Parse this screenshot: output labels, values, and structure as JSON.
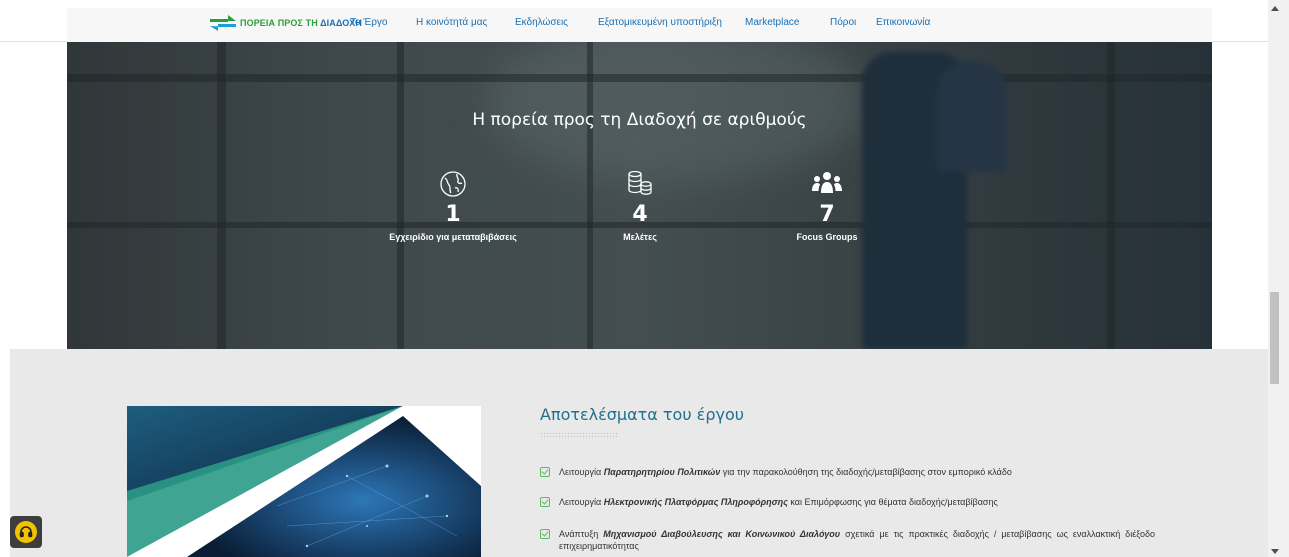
{
  "header": {
    "logo_text_green": "ΠΟΡΕΙΑ ΠΡΟΣ ΤΗ",
    "logo_text_blue": "ΔΙΑΔΟΧΗ",
    "nav": [
      {
        "label": "Το Έργο"
      },
      {
        "label": "Η κοινότητά μας"
      },
      {
        "label": "Εκδηλώσεις"
      },
      {
        "label": "Εξατομικευμένη υποστήριξη"
      },
      {
        "label": "Marketplace"
      },
      {
        "label": "Πόροι"
      },
      {
        "label": "Επικοινωνία"
      }
    ]
  },
  "hero": {
    "title": "Η πορεία προς τη Διαδοχή σε αριθμούς",
    "stats": [
      {
        "icon": "globe-icon",
        "number": "1",
        "label": "Εγχειρίδιο για μεταταβιβάσεις"
      },
      {
        "icon": "coins-stack-icon",
        "number": "4",
        "label": "Μελέτες"
      },
      {
        "icon": "users-group-icon",
        "number": "7",
        "label": "Focus Groups"
      }
    ]
  },
  "results": {
    "title": "Αποτελέσματα του έργου",
    "items": [
      {
        "pre": "Λειτουργία ",
        "bold": "Παρατηρητηρίου Πολιτικών",
        "post": " για την παρακολούθηση της διαδοχής/μεταβίβασης στον εμπορικό κλάδο"
      },
      {
        "pre": "Λειτουργία ",
        "bold": "Ηλεκτρονικής Πλατφόρμας Πληροφόρησης",
        "post": " και Επιμόρφωσης για θέματα διαδοχής/μεταβίβασης"
      },
      {
        "pre": "Ανάπτυξη ",
        "bold": "Μηχανισμού Διαβούλευσης και Κοινωνικού Διαλόγου",
        "post": " σχετικά με τις πρακτικές διαδοχής / μεταβίβασης ως εναλλακτική διέξοδο",
        "post2": "επιχειρηματικότητας"
      }
    ]
  },
  "colors": {
    "accent_blue": "#1a6fb3",
    "logo_green": "#2e9e3a",
    "results_title": "#1f6f8f",
    "check_green": "#5fba5f",
    "a11y_yellow": "#f2c200"
  }
}
